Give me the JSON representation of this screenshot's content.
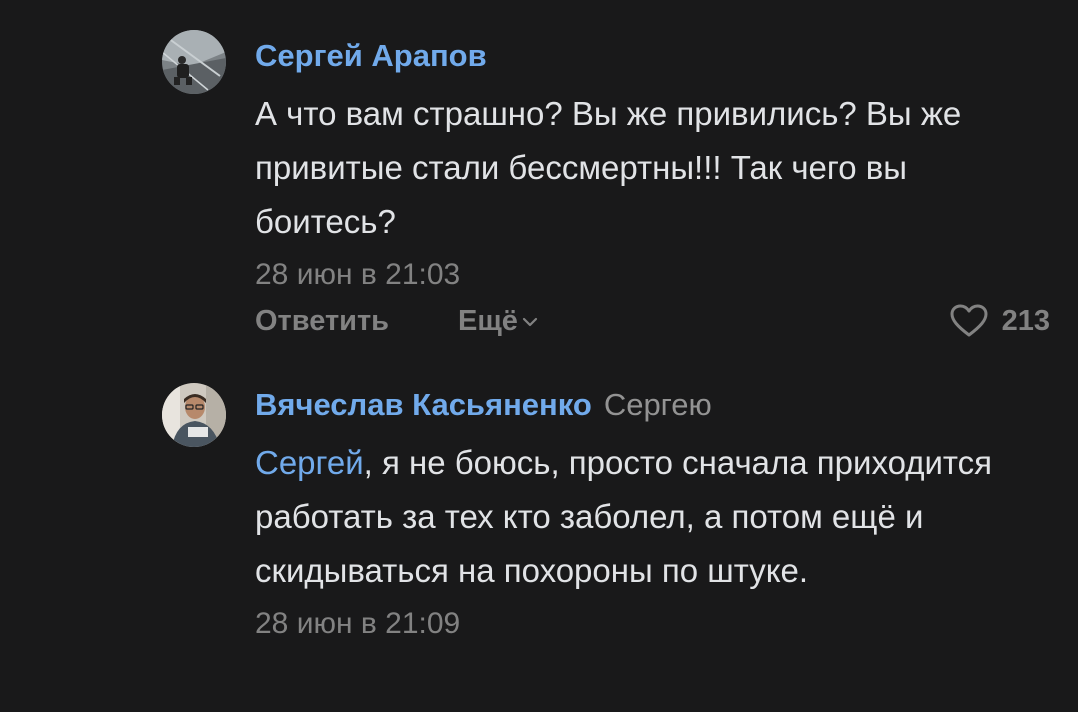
{
  "comments": [
    {
      "author": "Сергей Арапов",
      "reply_to": "",
      "mention": "",
      "text": "А что вам страшно? Вы же привились? Вы же привитые стали бессмертны!!! Так чего вы боитесь?",
      "time": "28 июн в 21:03",
      "actions": {
        "reply_label": "Ответить",
        "more_label": "Ещё",
        "likes": "213"
      }
    },
    {
      "author": "Вячеслав Касьяненко",
      "reply_to": "Сергею",
      "mention": "Сергей",
      "text": ", я не боюсь, просто сначала приходится работать за тех кто заболел, а потом ещё и скидываться на похороны по штуке.",
      "time": "28 июн в 21:09"
    }
  ],
  "colors": {
    "background": "#19191a",
    "link": "#71aaeb",
    "text": "#e1e3e6",
    "secondary": "#828282"
  }
}
